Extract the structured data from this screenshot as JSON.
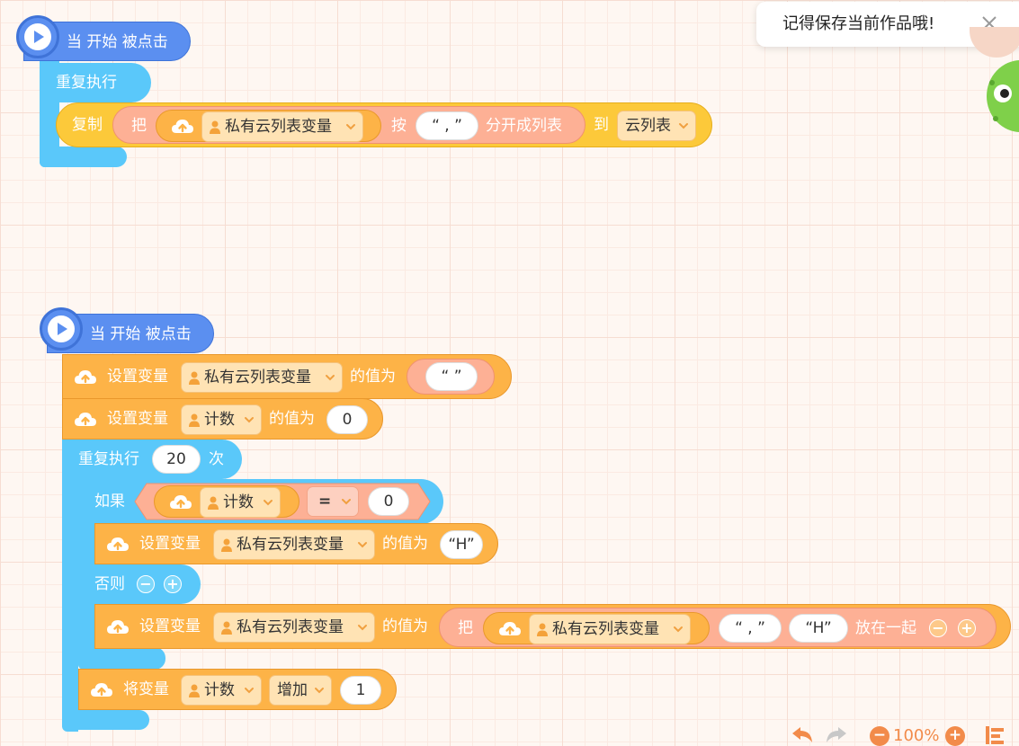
{
  "toast": {
    "message": "记得保存当前作品哦!",
    "close_icon": "close-icon"
  },
  "script1": {
    "hat_label": "当 开始 被点击",
    "loop_label": "重复执行",
    "copy_label": "复制",
    "split": {
      "ba": "把",
      "variable": "私有云列表变量",
      "by": "按",
      "separator": "“ , ”",
      "split_into": "分开成列表"
    },
    "to_label": "到",
    "target_list": "云列表"
  },
  "script2": {
    "hat_label": "当 开始 被点击",
    "set1": {
      "label": "设置变量",
      "variable": "私有云列表变量",
      "value_label": "的值为",
      "value": "“ ”"
    },
    "set2": {
      "label": "设置变量",
      "variable": "计数",
      "value_label": "的值为",
      "value": "0"
    },
    "repeat": {
      "label": "重复执行",
      "count": "20",
      "times": "次"
    },
    "if": {
      "label": "如果",
      "variable": "计数",
      "operator": "=",
      "value": "0"
    },
    "then_set": {
      "label": "设置变量",
      "variable": "私有云列表变量",
      "value_label": "的值为",
      "value": "“H”"
    },
    "else_label": "否则",
    "else_set": {
      "label": "设置变量",
      "variable": "私有云列表变量",
      "value_label": "的值为",
      "join_ba": "把",
      "join_var": "私有云列表变量",
      "join_sep": "“ , ”",
      "join_val": "“H”",
      "join_label": "放在一起"
    },
    "change": {
      "label": "将变量",
      "variable": "计数",
      "op": "增加",
      "value": "1"
    }
  },
  "toolbar": {
    "zoom": "100%"
  },
  "colors": {
    "control": "#5ac8fa",
    "event": "#5b8ff0",
    "variable": "#fdb347",
    "list": "#fcc93a",
    "operator": "#fdb095"
  }
}
